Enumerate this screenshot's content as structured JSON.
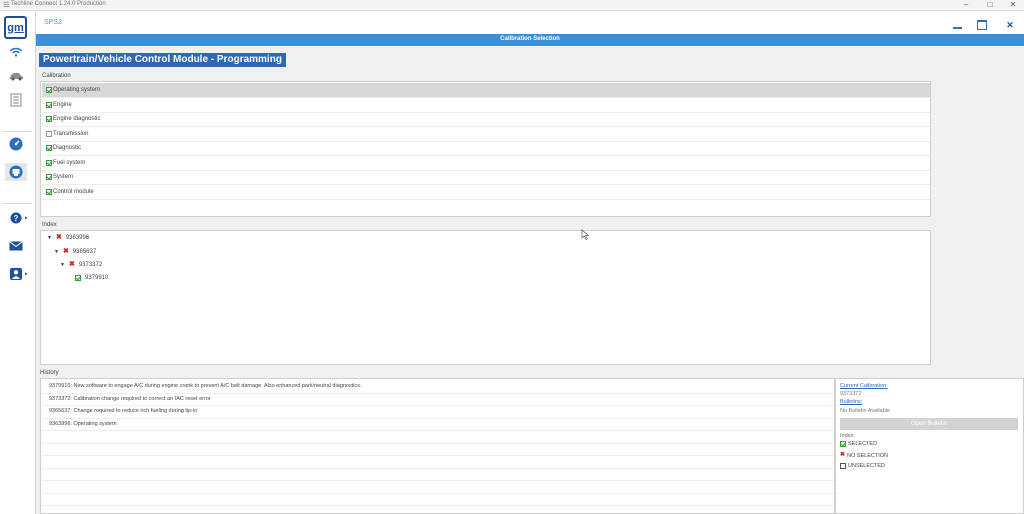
{
  "os": {
    "title": "Techline Connect 1.24.0 Production",
    "controls": [
      "–",
      "□",
      "✕"
    ]
  },
  "rail": {
    "logo": "gm",
    "icons": [
      "wifi-icon",
      "vehicle-icon",
      "document-icon",
      "gauge-icon",
      "module-icon",
      "help-icon",
      "mail-icon",
      "user-icon"
    ]
  },
  "window": {
    "app_name": "SPS2",
    "header": "Calibration Selection"
  },
  "program_title": "Powertrain/Vehicle Control Module - Programming",
  "calibration": {
    "label": "Calibration",
    "items": [
      {
        "label": "Operating system",
        "checked": true,
        "selected": true
      },
      {
        "label": "Engine",
        "checked": true,
        "selected": false
      },
      {
        "label": "Engine diagnostic",
        "checked": true,
        "selected": false
      },
      {
        "label": "Transmission",
        "checked": false,
        "selected": false
      },
      {
        "label": "Diagnostic",
        "checked": true,
        "selected": false
      },
      {
        "label": "Fuel system",
        "checked": true,
        "selected": false
      },
      {
        "label": "System",
        "checked": true,
        "selected": false
      },
      {
        "label": "Control module",
        "checked": true,
        "selected": false
      }
    ]
  },
  "index": {
    "label": "Index",
    "nodes": [
      {
        "id": "9363996",
        "state": "no-selection",
        "level": 0
      },
      {
        "id": "9365637",
        "state": "no-selection",
        "level": 1
      },
      {
        "id": "9373372",
        "state": "no-selection",
        "level": 2
      },
      {
        "id": "9379910",
        "state": "selected",
        "level": 3
      }
    ]
  },
  "history": {
    "label": "History",
    "rows": [
      "9379910: New software to engage A/C during engine crank to prevent A/C belt damage.  Also enhanced park/neutral diagnostics.",
      "9373372: Calibration change required to correct an IAC reset error",
      "9365637: Change required to reduce rich fueling during tip-in",
      "9363996: Operating system"
    ]
  },
  "side": {
    "current_calibration_label": "Current Calibration:",
    "current_calibration_value": "9373372",
    "bulletins_label": "Bulletins:",
    "bulletins_value": "No Bulletin Available",
    "open_bulletin_button": "Open Bulletin",
    "legend_label": "Index:",
    "legend": {
      "selected": "SELECTED",
      "no_selection": "NO SELECTION",
      "unselected": "UNSELECTED"
    }
  },
  "colors": {
    "header_blue": "#3c8fd6",
    "title_blue": "#2e67b6",
    "check_green": "#2d9a2d",
    "x_red": "#d02424"
  }
}
